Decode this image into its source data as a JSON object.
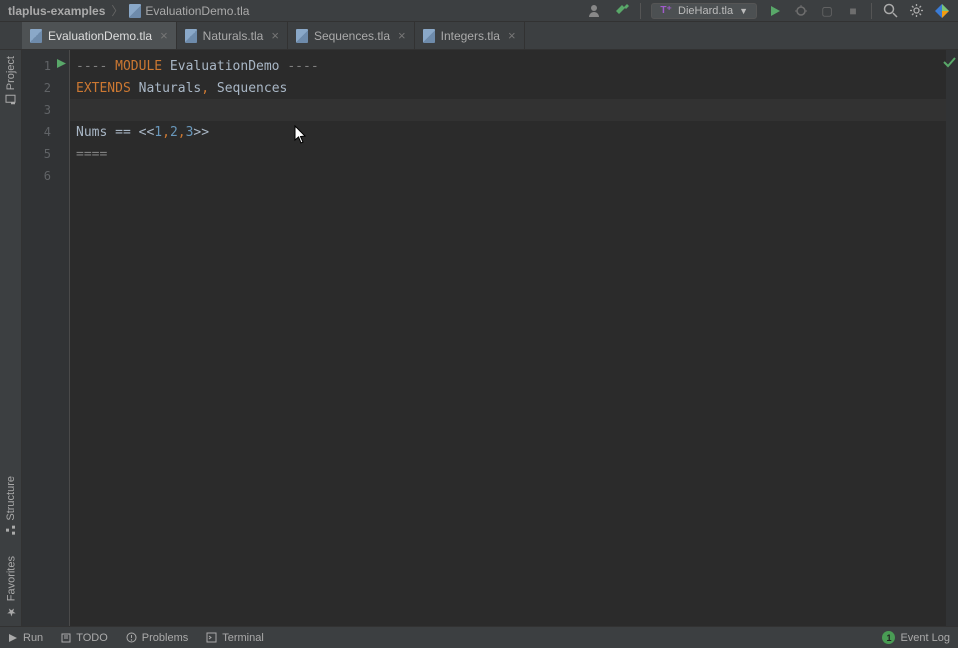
{
  "breadcrumb": {
    "project": "tlaplus-examples",
    "file": "EvaluationDemo.tla"
  },
  "runConfig": {
    "label": "DieHard.tla"
  },
  "tabs": [
    {
      "label": "EvaluationDemo.tla",
      "active": true
    },
    {
      "label": "Naturals.tla",
      "active": false
    },
    {
      "label": "Sequences.tla",
      "active": false
    },
    {
      "label": "Integers.tla",
      "active": false
    }
  ],
  "sideTools": {
    "project": "Project",
    "structure": "Structure",
    "favorites": "Favorites"
  },
  "gutter": {
    "lines": [
      "1",
      "2",
      "3",
      "4",
      "5",
      "6"
    ]
  },
  "code": {
    "line1": {
      "dash1": "---- ",
      "module": "MODULE",
      "name": " EvaluationDemo ",
      "dash2": "----"
    },
    "line2": {
      "extends": "EXTENDS",
      "n1": " Naturals",
      "comma": ",",
      "n2": " Sequences"
    },
    "line3": "",
    "line4": {
      "nums": "Nums ",
      "eq": "== ",
      "open": "<<",
      "v1": "1",
      "c1": ",",
      "v2": "2",
      "c2": ",",
      "v3": "3",
      "close": ">>"
    },
    "line5": "====",
    "line6": ""
  },
  "bottomBar": {
    "run": "Run",
    "todo": "TODO",
    "problems": "Problems",
    "terminal": "Terminal",
    "eventLog": "Event Log",
    "eventCount": "1"
  }
}
